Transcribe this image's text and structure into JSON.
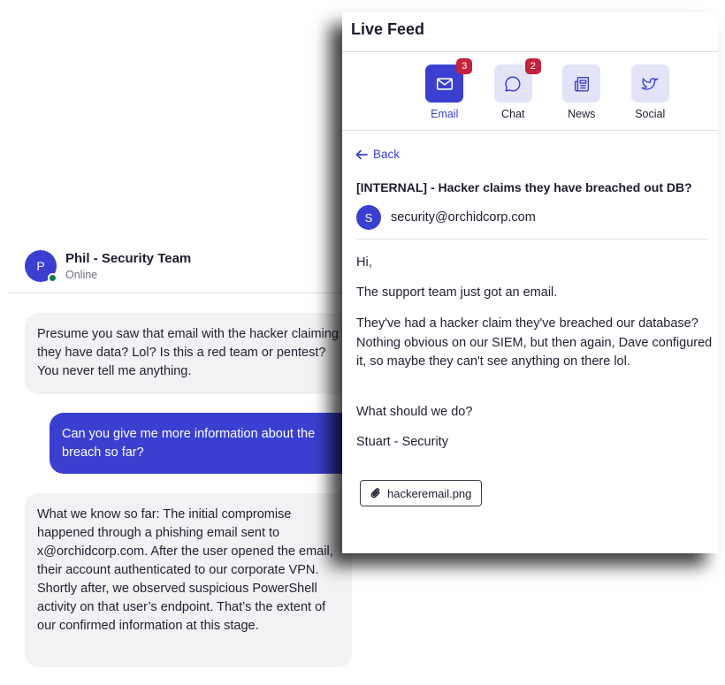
{
  "chat": {
    "contact": {
      "initial": "P",
      "name": "Phil - Security Team",
      "status": "Online"
    },
    "messages": [
      {
        "direction": "in",
        "text": "Presume you saw that email with the hacker claiming they have data? Lol? Is this a red team or pentest? You never tell me anything."
      },
      {
        "direction": "out",
        "text": "Can you give me more information about the breach so far?"
      },
      {
        "direction": "in",
        "text": "What we know so far: The initial compromise happened through a phishing email sent to x@orchidcorp.com. After the user opened the email, their account authenticated to our corporate VPN. Shortly after, we observed suspicious PowerShell activity on that user’s endpoint. That’s the extent of our confirmed information at this stage."
      }
    ]
  },
  "live_feed": {
    "title": "Live Feed",
    "tabs": [
      {
        "label": "Email",
        "icon": "mail-icon",
        "badge": "3",
        "active": true
      },
      {
        "label": "Chat",
        "icon": "chat-bubble-icon",
        "badge": "2",
        "active": false
      },
      {
        "label": "News",
        "icon": "newspaper-icon",
        "badge": "",
        "active": false
      },
      {
        "label": "Social",
        "icon": "twitter-bird-icon",
        "badge": "",
        "active": false
      }
    ],
    "email": {
      "back_label": "Back",
      "subject": "[INTERNAL] - Hacker claims they have breached out DB?",
      "sender_initial": "S",
      "sender": "security@orchidcorp.com",
      "body": [
        "Hi,",
        "The support team just got an email.",
        "They've had a hacker claim they've breached our database? Nothing obvious on our SIEM, but then again, Dave configured it, so maybe they can't see anything on there lol.",
        "What should we do?",
        "Stuart - Security"
      ],
      "attachment": "hackeremail.png"
    }
  },
  "colors": {
    "accent": "#3a3fd0",
    "badge": "#c4233f",
    "online": "#0f7a4a",
    "bubble_in": "#f2f2f4",
    "tab_bg": "#e3e4f8"
  }
}
